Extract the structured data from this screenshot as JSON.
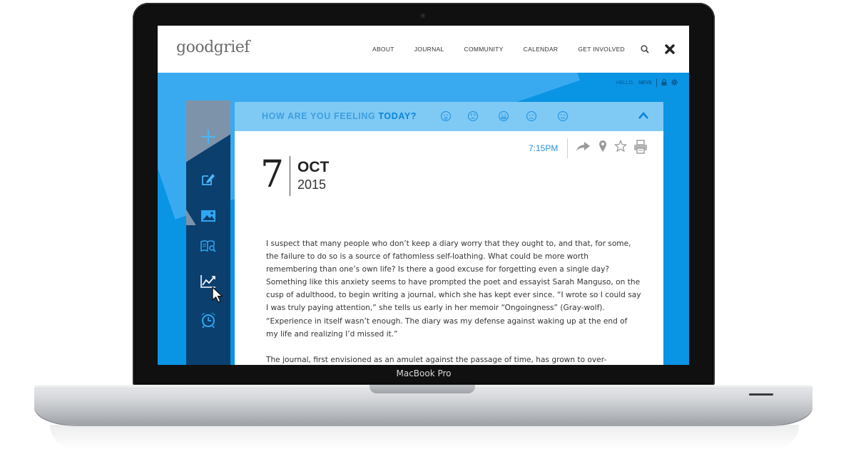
{
  "device": {
    "model_label": "MacBook Pro"
  },
  "site": {
    "logo": "goodgrief",
    "nav": [
      "ABOUT",
      "JOURNAL",
      "COMMUNITY",
      "CALENDAR",
      "GET INVOLVED"
    ],
    "nav_icons": [
      "search-icon",
      "close-icon"
    ]
  },
  "user": {
    "greeting": "HELLO,",
    "name": "NEVE",
    "icons": [
      "lock-icon",
      "settings-icon"
    ]
  },
  "sidebar": {
    "items": [
      "add-icon",
      "edit-note-icon",
      "image-icon",
      "book-search-icon",
      "chart-icon",
      "alarm-clock-icon"
    ]
  },
  "mood_bar": {
    "label_start": "HOW ARE YOU FEELING",
    "label_bold": "TODAY?",
    "moods": [
      "surprised-face-icon",
      "worried-face-icon",
      "grimace-face-icon",
      "sad-face-icon",
      "happy-face-icon"
    ]
  },
  "entry": {
    "time": "7:15PM",
    "tools": [
      "share-icon",
      "location-icon",
      "star-icon",
      "print-icon"
    ],
    "day": "7",
    "month": "OCT",
    "year": "2015",
    "paragraphs": [
      "I suspect that many people who don’t keep a diary worry that they ought to, and that, for some, the failure to do so is a source of fathomless self-loathing. What could be more worth remembering than one’s own life? Is there a good excuse for forgetting even a single day? Something like this anxiety seems to have prompted the poet and essayist Sarah Manguso, on the cusp of adulthood, to begin writing a journal, which she has kept ever since. “I wrote so I could say I was truly paying attention,” she tells us early in her memoir “Ongoingness” (Gray-wolf). “Experience in itself wasn’t enough. The diary was my defense against waking up at the end of my life and realizing I’d missed it.”",
      "The journal, first envisioned as an amulet against the passage of time, has grown to over-"
    ]
  },
  "colors": {
    "accent": "#0a94e4",
    "sidebar": "#0a3f6e",
    "mood_bar": "#7fcaf5",
    "link": "#2a90d6"
  }
}
